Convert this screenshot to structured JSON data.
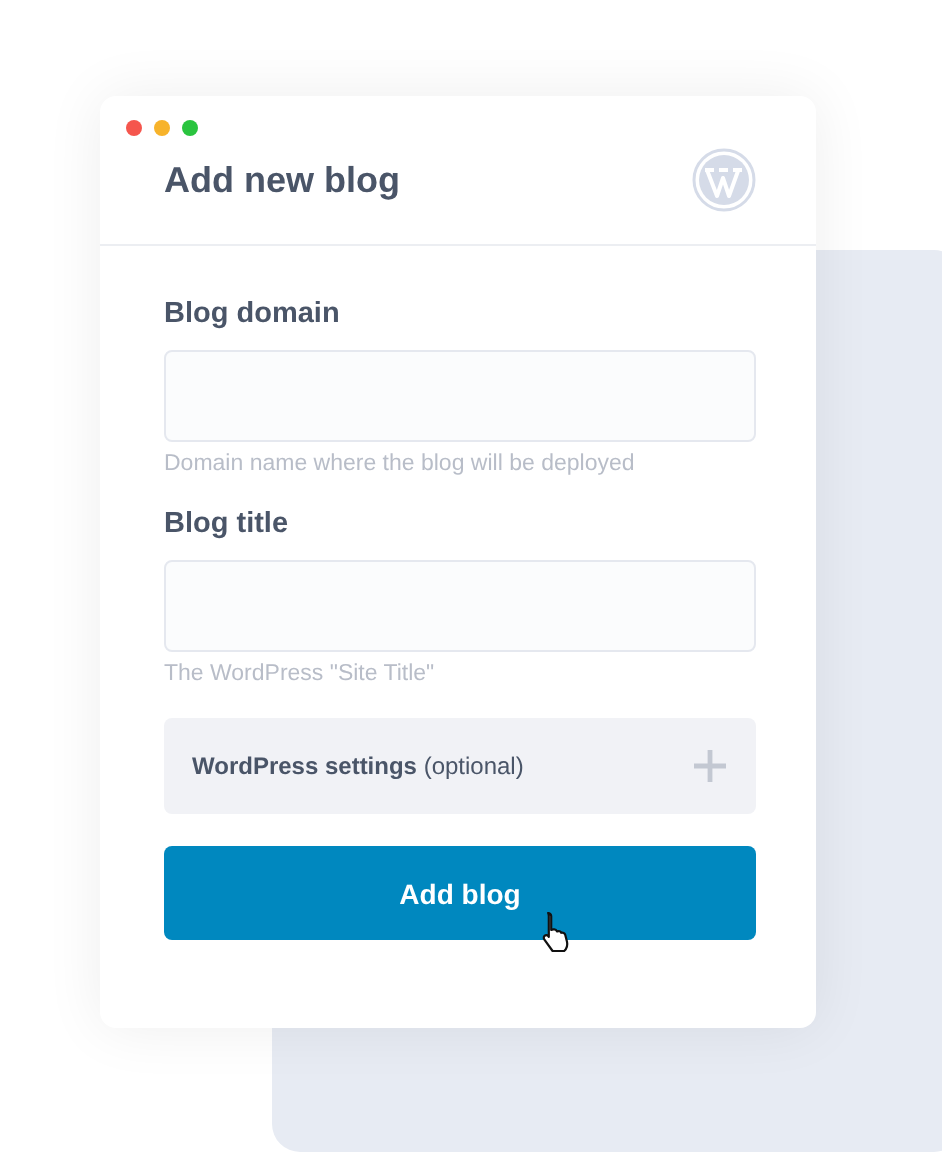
{
  "window": {
    "title": "Add new blog"
  },
  "fields": [
    {
      "label": "Blog domain",
      "hint": "Domain name where the blog will be deployed"
    },
    {
      "label": "Blog title",
      "hint": "The WordPress \"Site Title\""
    }
  ],
  "settings": {
    "label": "**WordPress settings** (optional)",
    "expanded": false
  },
  "button": {
    "label": "Add blog"
  }
}
